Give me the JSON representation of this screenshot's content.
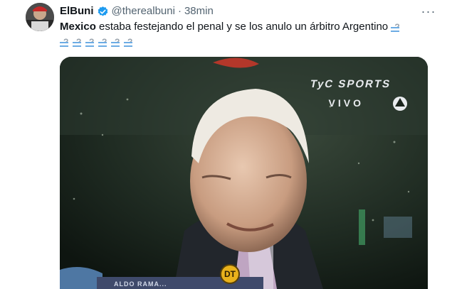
{
  "tweet": {
    "display_name": "ElBuni",
    "handle": "@therealbuni",
    "separator": "·",
    "time": "38min",
    "more_label": "···",
    "text_bold": "Mexico",
    "text_rest": " estaba festejando el penal y se los anulo un árbitro Argentino "
  },
  "video": {
    "broadcaster_logo": "TyC SPORTS",
    "live_label": "VIVO",
    "badge": "DT",
    "caption": "ALDO RAMA..."
  },
  "icons": [
    "verified-badge-icon",
    "more-options-icon",
    "flag-emoji-icon",
    "broadcaster-crest-icon"
  ],
  "colors": {
    "text_primary": "#0f1419",
    "text_secondary": "#536471",
    "verified_blue": "#1d9bf0",
    "video_bg": "#1b241d"
  }
}
